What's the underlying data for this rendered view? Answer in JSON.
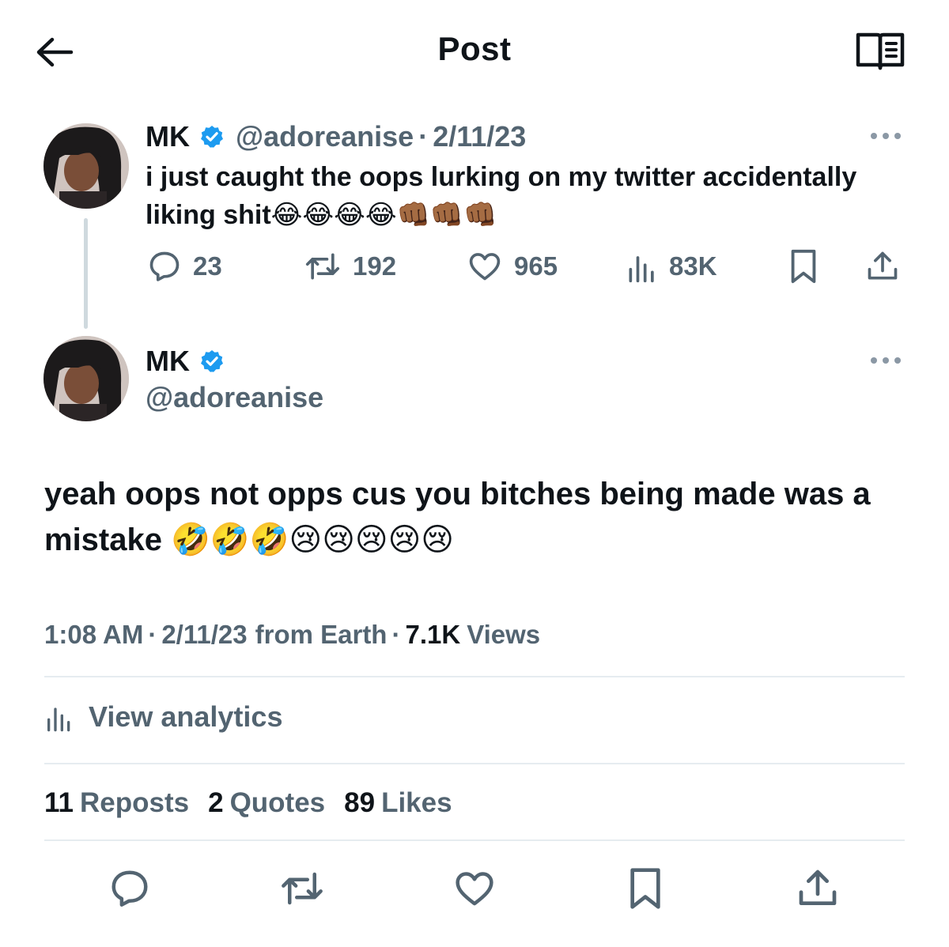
{
  "header": {
    "title": "Post",
    "back_icon": "arrow-left-icon",
    "reader_icon": "reader-mode-icon"
  },
  "colors": {
    "verified": "#1d9bf0",
    "text_primary": "#0f1419",
    "text_secondary": "#536471",
    "divider": "#e6ecf0"
  },
  "parent_tweet": {
    "name": "MK",
    "handle": "@adoreanise",
    "separator": "·",
    "date": "2/11/23",
    "text": "i just caught the oops lurking on my twitter accidentally liking shit😂😂😂😂👊🏾👊🏾👊🏾",
    "actions": {
      "replies": "23",
      "reposts": "192",
      "likes": "965",
      "views": "83K"
    }
  },
  "main_tweet": {
    "name": "MK",
    "handle": "@adoreanise",
    "text": "yeah oops not opps cus you bitches being made was a mistake 🤣🤣🤣😢😢😢😢😢",
    "time": "1:08 AM",
    "separator": "·",
    "date": "2/11/23",
    "source": "from Earth",
    "views_count": "7.1K",
    "views_label": "Views",
    "analytics_label": "View analytics",
    "stats": {
      "reposts_count": "11",
      "reposts_label": "Reposts",
      "quotes_count": "2",
      "quotes_label": "Quotes",
      "likes_count": "89",
      "likes_label": "Likes"
    }
  }
}
